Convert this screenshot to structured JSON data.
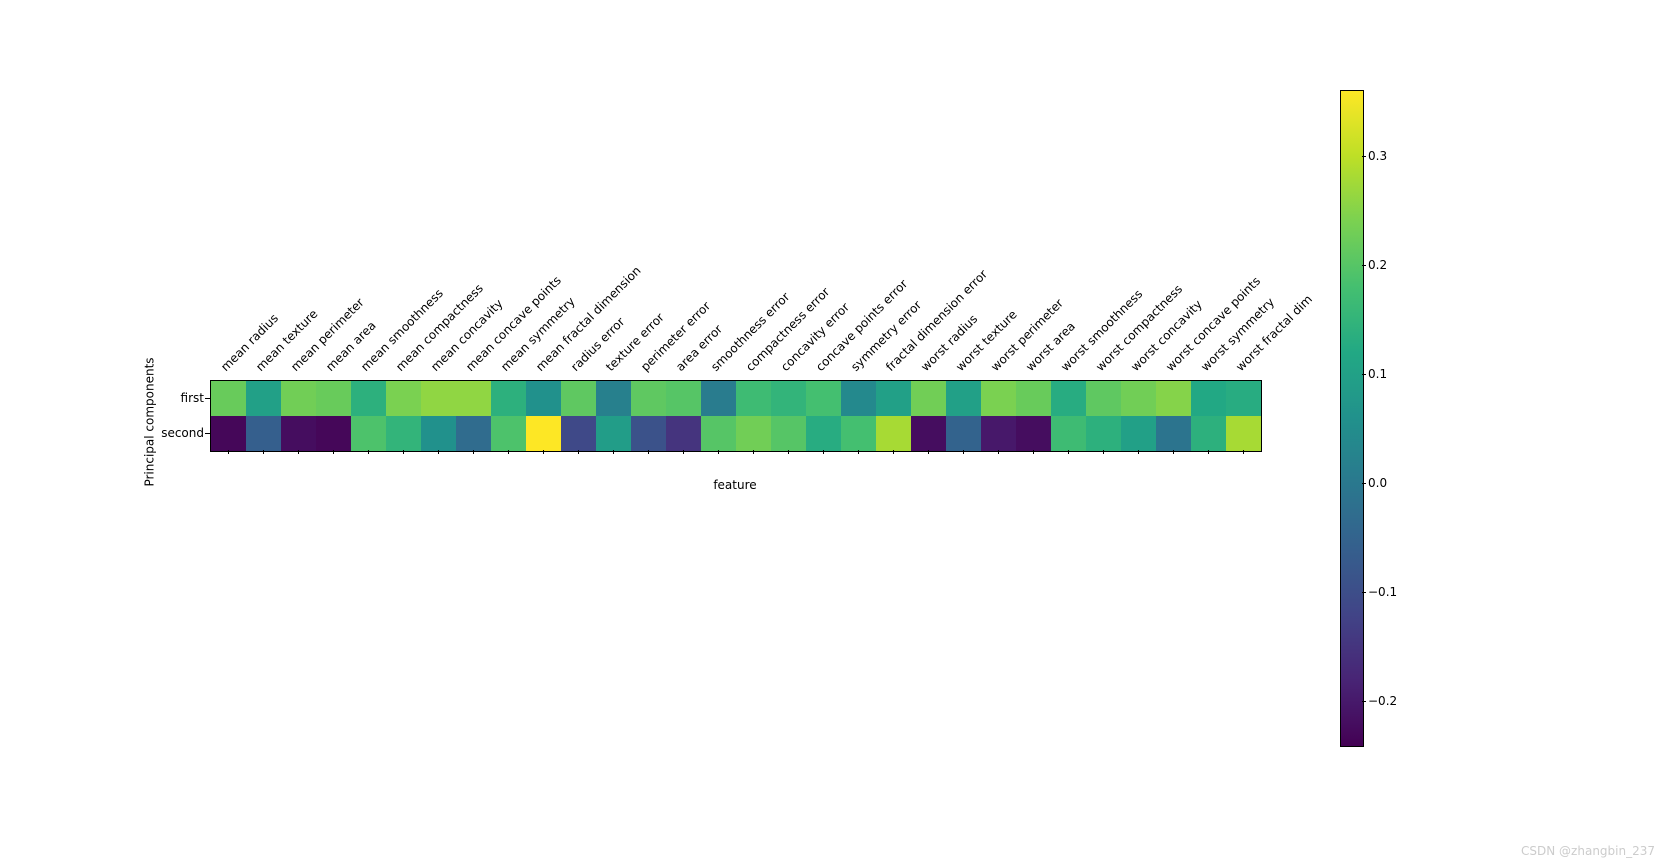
{
  "chart_data": {
    "type": "heatmap",
    "ylabel": "Principal components",
    "xlabel": "feature",
    "yticks": [
      "first",
      "second"
    ],
    "xticks": [
      "mean radius",
      "mean texture",
      "mean perimeter",
      "mean area",
      "mean smoothness",
      "mean compactness",
      "mean concavity",
      "mean concave points",
      "mean symmetry",
      "mean fractal dimension",
      "radius error",
      "texture error",
      "perimeter error",
      "area error",
      "smoothness error",
      "compactness error",
      "concavity error",
      "concave points error",
      "symmetry error",
      "fractal dimension error",
      "worst radius",
      "worst texture",
      "worst perimeter",
      "worst area",
      "worst smoothness",
      "worst compactness",
      "worst concavity",
      "worst concave points",
      "worst symmetry",
      "worst fractal dim"
    ],
    "cbar_ticks": [
      "0.3",
      "0.2",
      "0.1",
      "0.0",
      "−0.1",
      "−0.2"
    ],
    "cbar_tick_values": [
      0.3,
      0.2,
      0.1,
      0.0,
      -0.1,
      -0.2
    ],
    "vmin": -0.24,
    "vmax": 0.36,
    "series": [
      {
        "name": "first",
        "values": [
          0.22,
          0.1,
          0.23,
          0.22,
          0.14,
          0.24,
          0.26,
          0.26,
          0.14,
          0.06,
          0.21,
          0.02,
          0.21,
          0.2,
          0.01,
          0.17,
          0.15,
          0.18,
          0.04,
          0.1,
          0.23,
          0.1,
          0.24,
          0.22,
          0.13,
          0.21,
          0.23,
          0.25,
          0.12,
          0.13
        ]
      },
      {
        "name": "second",
        "values": [
          -0.23,
          -0.06,
          -0.22,
          -0.23,
          0.19,
          0.15,
          0.06,
          -0.03,
          0.19,
          0.36,
          -0.11,
          0.09,
          -0.09,
          -0.15,
          0.2,
          0.23,
          0.2,
          0.13,
          0.18,
          0.28,
          -0.22,
          -0.05,
          -0.2,
          -0.22,
          0.17,
          0.14,
          0.1,
          -0.01,
          0.14,
          0.28
        ]
      }
    ]
  },
  "watermark": "CSDN @zhangbin_237"
}
